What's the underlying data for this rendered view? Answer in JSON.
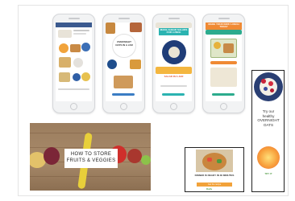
{
  "phones": [
    {
      "banner": ""
    },
    {
      "banner": "OVERNIGHT OATS IN A JAR"
    },
    {
      "banner": "MAKE-AHEAD SALADS FOR LUNCH"
    },
    {
      "banner": "MAKE YOUR KIDS' LUNCH TODAY"
    }
  ],
  "photo": {
    "title_line1": "HOW TO STORE",
    "title_line2": "FRUITS & VEGGIES"
  },
  "ad_small": {
    "caption": "DINNER IS READY IN 30 MINUTES",
    "button": "Get the recipe",
    "logo": "Daily"
  },
  "ad_tall": {
    "line1": "Try our",
    "line2": "healthy",
    "line3": "OVERNIGHT",
    "line4": "OATS",
    "logo": "TRY IT"
  },
  "colors": {
    "phone_banner_teal": "#2bb3b1",
    "phone_banner_orange": "#f08a34",
    "phone_banner_green": "#2cab8d",
    "wood": "#a88a6a",
    "ad_button": "#f2a23a"
  }
}
